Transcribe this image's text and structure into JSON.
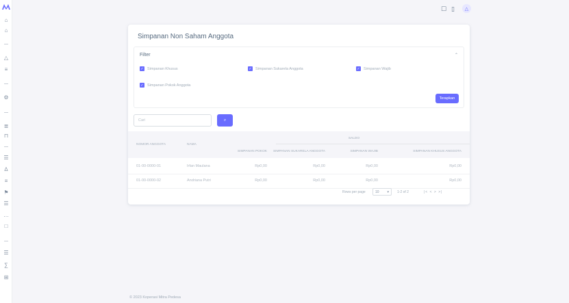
{
  "topbar": {
    "icons": [
      "window-icon",
      "mobile-icon"
    ]
  },
  "sidebar": {
    "logo": "logo-icon",
    "icons": [
      "lock-icon",
      "lock-icon",
      "",
      "warning-icon",
      "chart-icon",
      "",
      "dashboard-icon",
      "",
      "chart-bar-icon",
      "door-icon",
      "",
      "layout-icon",
      "user-icon",
      "list-icon",
      "flag-icon",
      "menu-icon",
      "dots-icon",
      "square-icon",
      "",
      "layout-icon",
      "sign-icon",
      "table-icon"
    ]
  },
  "card": {
    "title": "Simpanan Non Saham Anggota",
    "filter": {
      "label": "Filter",
      "checkboxes": [
        {
          "label": "Simpanan Khusus"
        },
        {
          "label": "Simpanan Sukarela Anggota"
        },
        {
          "label": "Simpanan Wajib"
        },
        {
          "label": "Simpanan Pokok Anggota"
        }
      ],
      "apply_label": "Terapkan"
    },
    "search": {
      "placeholder": "Cari",
      "button_label": "Cari"
    },
    "table": {
      "headers": {
        "group": "SALDO",
        "col1": "NOMOR ANGGOTA",
        "col2": "NAMA",
        "col3": "SIMPANAN POKOK",
        "col4": "SIMPANAN SUKARELA ANGGOTA",
        "col5": "SIMPANAN WAJIB",
        "col6": "SIMPANAN KHUSUS ANGGOTA"
      },
      "rows": [
        {
          "c1": "01-00-0000-01",
          "c2": "Irfan Maulana",
          "c3": "Rp0,00",
          "c4": "Rp0,00",
          "c5": "Rp0,00",
          "c6": "Rp0,00"
        },
        {
          "c1": "01-00-0000-02",
          "c2": "Andriana Putri",
          "c3": "Rp0,00",
          "c4": "Rp0,00",
          "c5": "Rp0,00",
          "c6": "Rp0,00"
        }
      ]
    },
    "pagination": {
      "rows_per_page_label": "Rows per page",
      "rows_per_page_value": "10",
      "range_text": "1-2 of 2",
      "nav": "|<  <  >  >|"
    }
  },
  "footer": {
    "text": "© 2023 Koperasi Mitra Pedesa"
  }
}
